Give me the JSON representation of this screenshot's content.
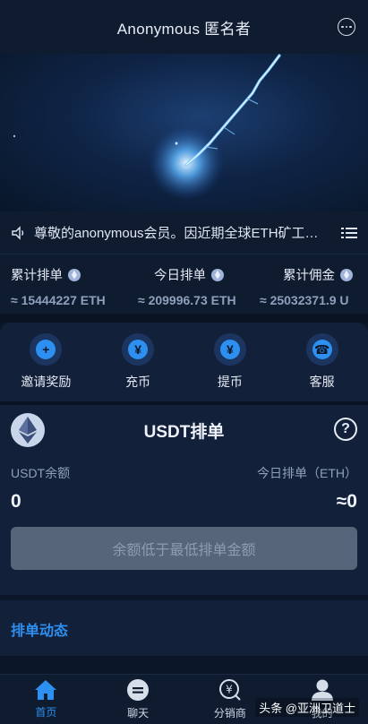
{
  "header": {
    "title": "Anonymous 匿名者",
    "chat_icon": "chat-bubble-icon"
  },
  "notice": {
    "text": "尊敬的anonymous会员。因近期全球ETH矿工…"
  },
  "stats": [
    {
      "label": "累计排单",
      "value": "≈ 15444227 ETH"
    },
    {
      "label": "今日排单",
      "value": "≈ 209996.73 ETH"
    },
    {
      "label": "累计佣金",
      "value": "≈ 25032371.9 U"
    }
  ],
  "actions": [
    {
      "label": "邀请奖励",
      "icon": "user-icon",
      "glyph": "+"
    },
    {
      "label": "充币",
      "icon": "deposit-icon",
      "glyph": "¥"
    },
    {
      "label": "提币",
      "icon": "withdraw-icon",
      "glyph": "¥"
    },
    {
      "label": "客服",
      "icon": "support-icon",
      "glyph": "☎"
    }
  ],
  "usdt": {
    "title": "USDT排单",
    "balance_label": "USDT余额",
    "today_label": "今日排单（ETH）",
    "balance_value": "0",
    "today_value": "≈0",
    "button_label": "余额低于最低排单金额"
  },
  "feed": {
    "title": "排单动态"
  },
  "tabs": [
    {
      "label": "首页",
      "icon": "home-icon"
    },
    {
      "label": "聊天",
      "icon": "chat-icon"
    },
    {
      "label": "分销商",
      "icon": "distributor-icon"
    },
    {
      "label": "我的",
      "icon": "profile-icon"
    }
  ],
  "watermark": "头条 @亚洲卫道士",
  "colors": {
    "accent": "#2d8ff0",
    "background": "#0b1628",
    "panel": "#13203a"
  }
}
